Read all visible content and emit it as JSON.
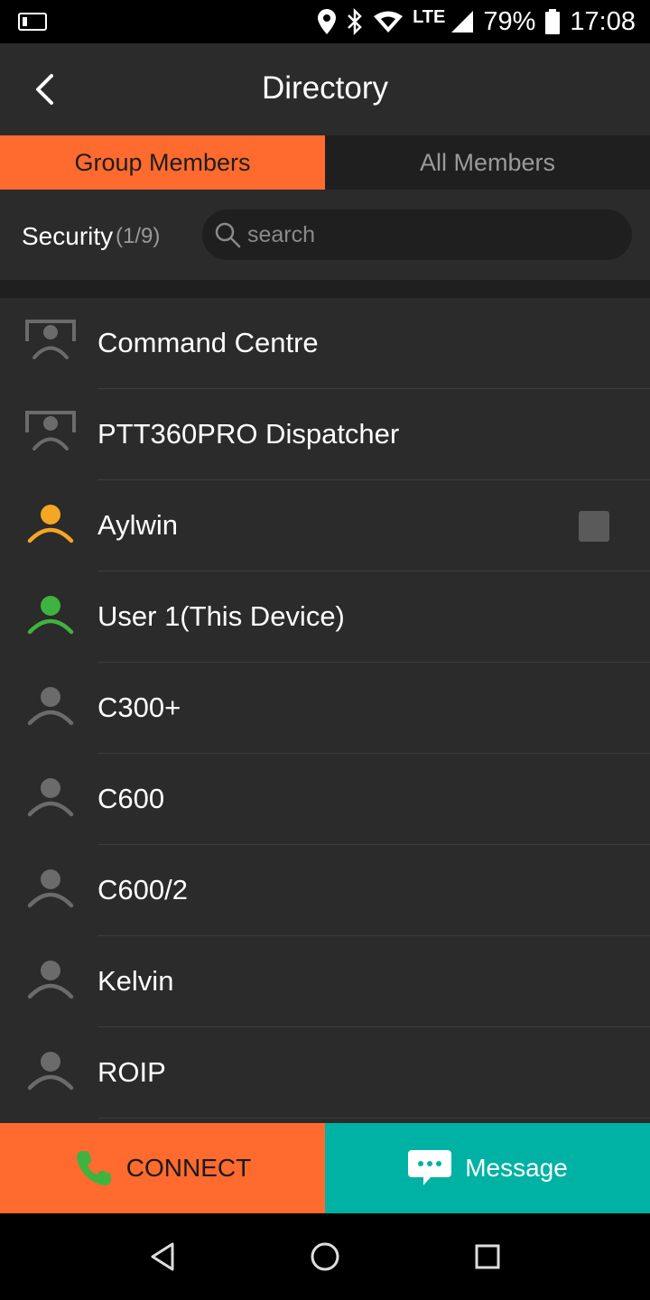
{
  "status_bar": {
    "battery": "79%",
    "time": "17:08",
    "network": "LTE",
    "icons": [
      "app-notification-icon",
      "location-icon",
      "bluetooth-icon",
      "wifi-icon",
      "signal-icon",
      "battery-icon"
    ]
  },
  "header": {
    "title": "Directory",
    "back_icon": "chevron-left-icon"
  },
  "tabs": [
    {
      "label": "Group Members",
      "active": true
    },
    {
      "label": "All Members",
      "active": false
    }
  ],
  "filter": {
    "group_name": "Security",
    "group_count": "(1/9)",
    "search_placeholder": "search"
  },
  "members": [
    {
      "name": "Command Centre",
      "type": "dispatcher",
      "status": "offline",
      "checkbox": false
    },
    {
      "name": "PTT360PRO Dispatcher",
      "type": "dispatcher",
      "status": "offline",
      "checkbox": false
    },
    {
      "name": "Aylwin",
      "type": "user",
      "status": "online",
      "checkbox": true
    },
    {
      "name": "User 1(This Device)",
      "type": "user",
      "status": "self",
      "checkbox": false
    },
    {
      "name": "C300+",
      "type": "user",
      "status": "offline",
      "checkbox": false
    },
    {
      "name": "C600",
      "type": "user",
      "status": "offline",
      "checkbox": false
    },
    {
      "name": "C600/2",
      "type": "user",
      "status": "offline",
      "checkbox": false
    },
    {
      "name": "Kelvin",
      "type": "user",
      "status": "offline",
      "checkbox": false
    },
    {
      "name": "ROIP",
      "type": "user",
      "status": "offline",
      "checkbox": false
    }
  ],
  "actions": {
    "connect_label": "CONNECT",
    "message_label": "Message"
  },
  "colors": {
    "accent": "#ff6a2f",
    "message": "#00b2a4",
    "online": "#f5a623",
    "self": "#3fb33f",
    "offline": "#6b6b6b",
    "phone": "#3fb33f"
  }
}
